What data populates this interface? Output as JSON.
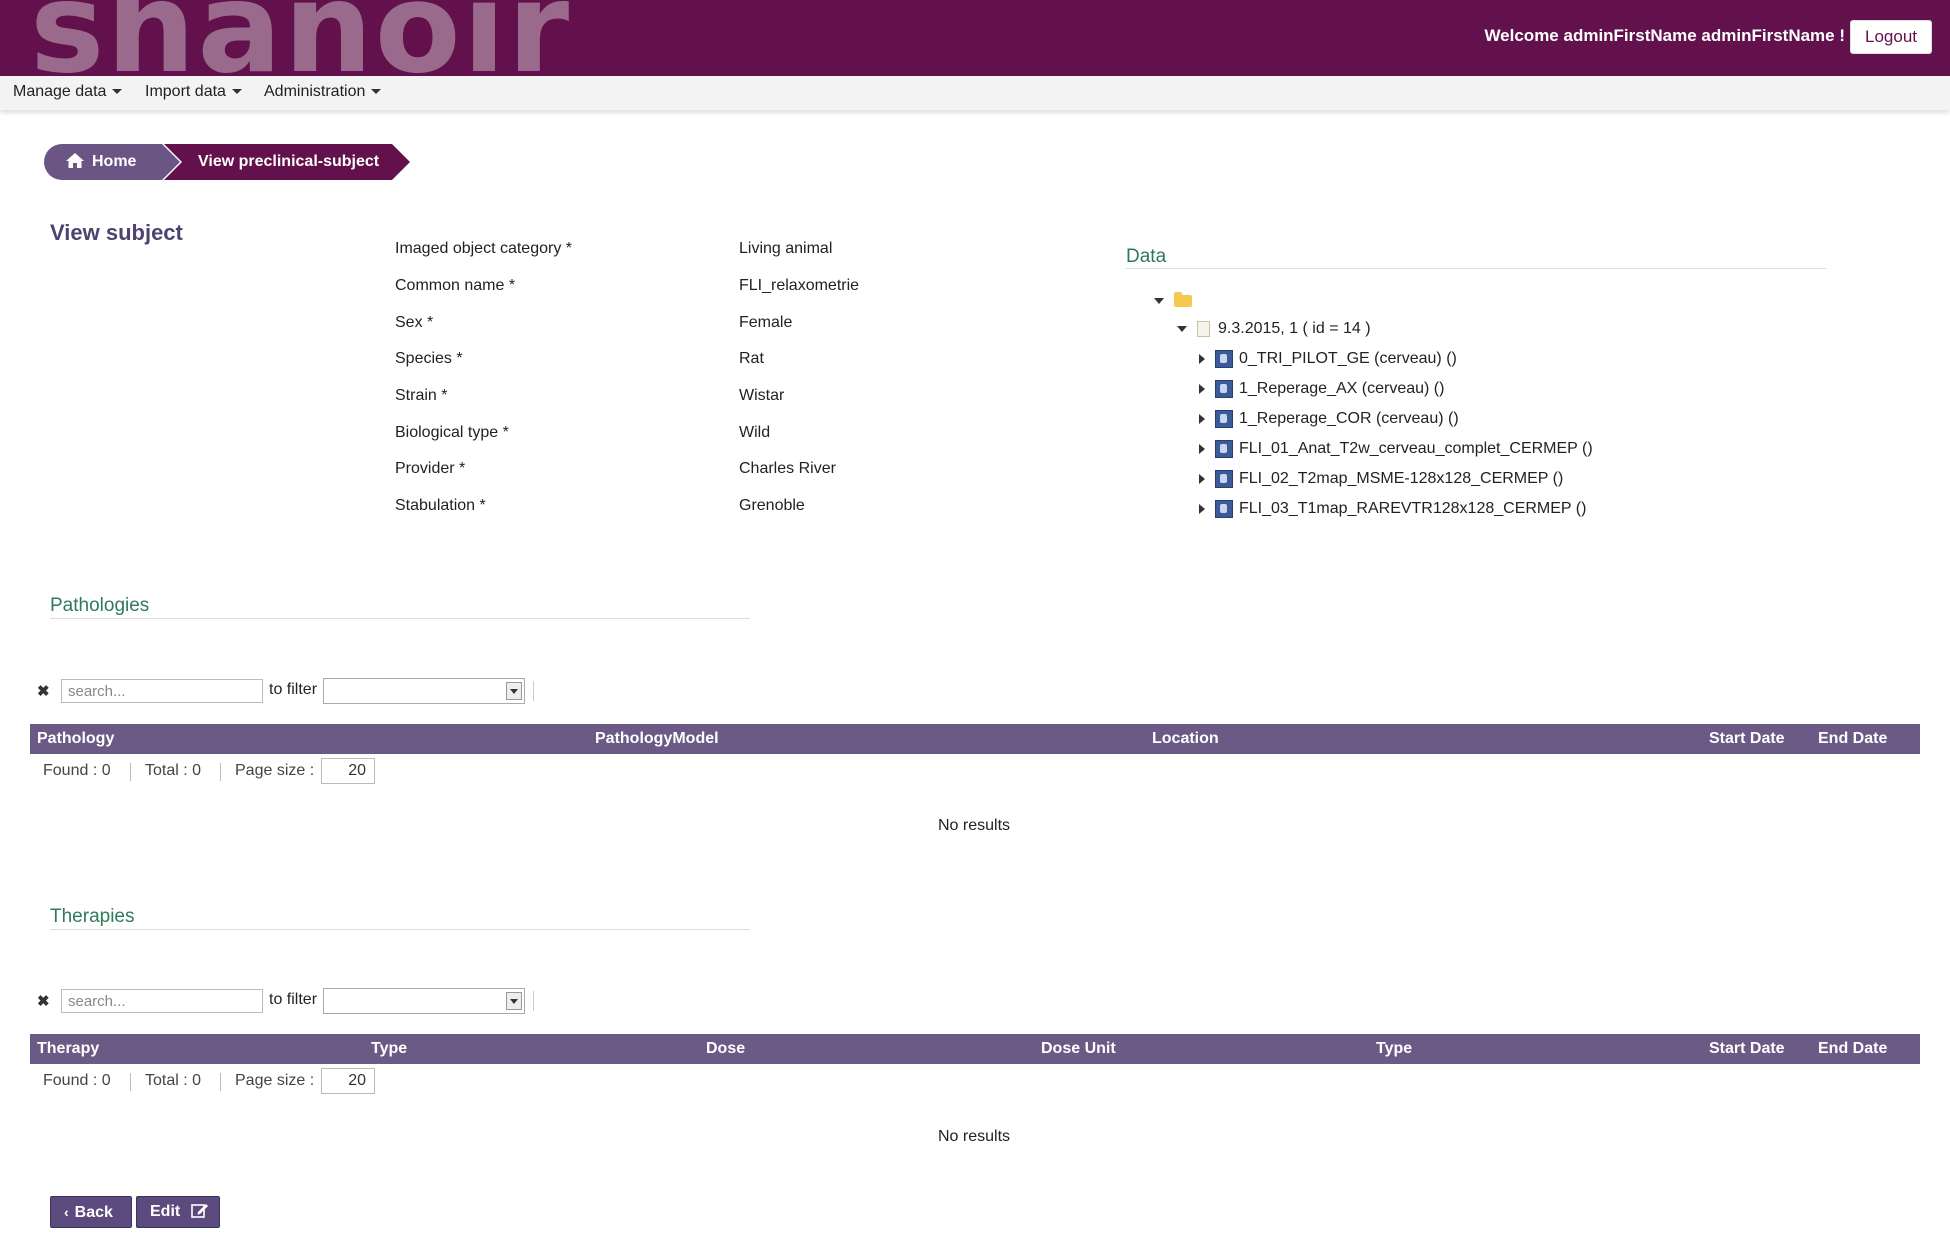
{
  "header": {
    "logo": "shanoir",
    "welcome": "Welcome adminFirstName adminFirstName !",
    "logout_label": "Logout"
  },
  "nav": {
    "items": [
      {
        "label": "Manage data"
      },
      {
        "label": "Import data"
      },
      {
        "label": "Administration"
      }
    ]
  },
  "breadcrumb": {
    "home": "Home",
    "current": "View preclinical-subject"
  },
  "page_title": "View subject",
  "subject": {
    "fields": [
      {
        "label": "Imaged object category *",
        "value": "Living animal"
      },
      {
        "label": "Common name *",
        "value": "FLI_relaxometrie"
      },
      {
        "label": "Sex *",
        "value": "Female"
      },
      {
        "label": "Species *",
        "value": "Rat"
      },
      {
        "label": "Strain *",
        "value": "Wistar"
      },
      {
        "label": "Biological type *",
        "value": "Wild"
      },
      {
        "label": "Provider *",
        "value": "Charles River"
      },
      {
        "label": "Stabulation *",
        "value": "Grenoble"
      }
    ]
  },
  "data_tree": {
    "heading": "Data",
    "exam": "9.3.2015, 1 ( id = 14 )",
    "series": [
      "0_TRI_PILOT_GE (cerveau) ()",
      "1_Reperage_AX (cerveau) ()",
      "1_Reperage_COR (cerveau) ()",
      "FLI_01_Anat_T2w_cerveau_complet_CERMEP ()",
      "FLI_02_T2map_MSME-128x128_CERMEP ()",
      "FLI_03_T1map_RAREVTR128x128_CERMEP ()"
    ]
  },
  "pathologies": {
    "heading": "Pathologies",
    "search_placeholder": "search...",
    "filter_label": "to filter",
    "columns": [
      "Pathology",
      "PathologyModel",
      "Location",
      "Start Date",
      "End Date"
    ],
    "found": "Found : 0",
    "total": "Total : 0",
    "page_size_label": "Page size :",
    "page_size": "20",
    "no_results": "No results"
  },
  "therapies": {
    "heading": "Therapies",
    "search_placeholder": "search...",
    "filter_label": "to filter",
    "columns": [
      "Therapy",
      "Type",
      "Dose",
      "Dose Unit",
      "Type",
      "Start Date",
      "End Date"
    ],
    "found": "Found : 0",
    "total": "Total : 0",
    "page_size_label": "Page size :",
    "page_size": "20",
    "no_results": "No results"
  },
  "footer": {
    "back_label": "Back",
    "edit_label": "Edit"
  },
  "colors": {
    "brand": "#63114c",
    "table_header": "#6b5a85",
    "section_heading": "#2f7a5a"
  }
}
